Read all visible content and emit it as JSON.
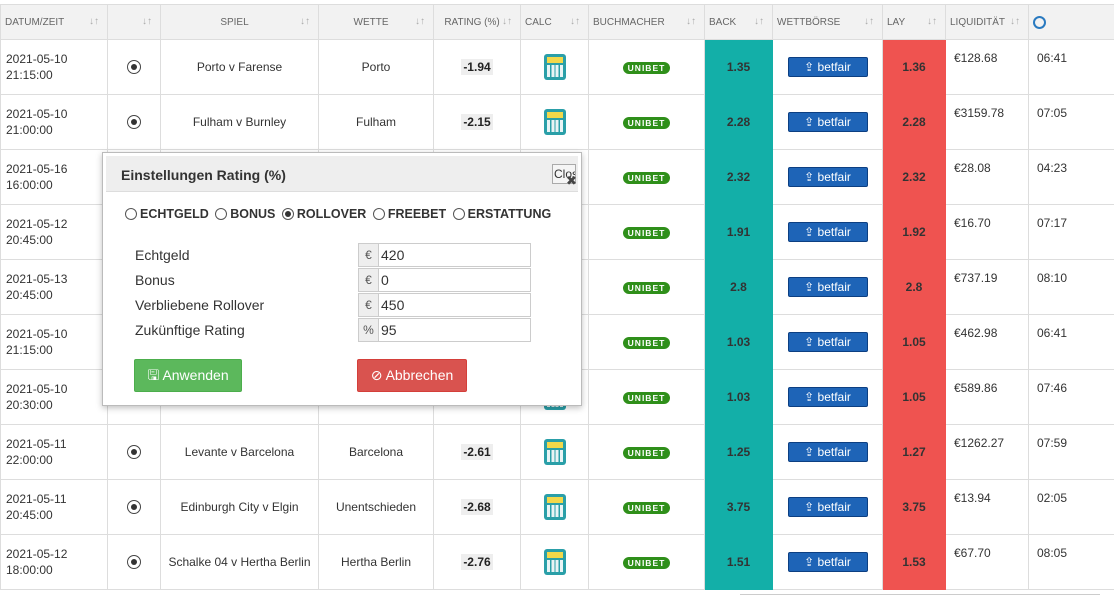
{
  "columns": [
    {
      "label": "DATUM/ZEIT",
      "sort": "↓↑"
    },
    {
      "label": "",
      "sort": "↓↑"
    },
    {
      "label": "SPIEL",
      "sort": "↓↑"
    },
    {
      "label": "WETTE",
      "sort": "↓↑"
    },
    {
      "label": "RATING (%)",
      "sort": "↓↑"
    },
    {
      "label": "CALC",
      "sort": "↓↑"
    },
    {
      "label": "BUCHMACHER",
      "sort": "↓↑"
    },
    {
      "label": "BACK",
      "sort": "↓↑"
    },
    {
      "label": "WETTBÖRSE",
      "sort": "↓↑"
    },
    {
      "label": "LAY",
      "sort": "↓↑"
    },
    {
      "label": "LIQUIDITÄT",
      "sort": "↓↑"
    },
    {
      "label": "",
      "sort": ""
    }
  ],
  "rows": [
    {
      "date": "2021-05-10",
      "time": "21:15:00",
      "match": "Porto v Farense",
      "bet": "Porto",
      "rating": "-1.94",
      "back": "1.35",
      "lay": "1.36",
      "liquidity": "€128.68",
      "eta": "06:41"
    },
    {
      "date": "2021-05-10",
      "time": "21:00:00",
      "match": "Fulham v Burnley",
      "bet": "Fulham",
      "rating": "-2.15",
      "back": "2.28",
      "lay": "2.28",
      "liquidity": "€3159.78",
      "eta": "07:05"
    },
    {
      "date": "2021-05-16",
      "time": "16:00:00",
      "match": "",
      "bet": "",
      "rating": "",
      "back": "2.32",
      "lay": "2.32",
      "liquidity": "€28.08",
      "eta": "04:23"
    },
    {
      "date": "2021-05-12",
      "time": "20:45:00",
      "match": "",
      "bet": "",
      "rating": "",
      "back": "1.91",
      "lay": "1.92",
      "liquidity": "€16.70",
      "eta": "07:17"
    },
    {
      "date": "2021-05-13",
      "time": "20:45:00",
      "match": "",
      "bet": "",
      "rating": "",
      "back": "2.8",
      "lay": "2.8",
      "liquidity": "€737.19",
      "eta": "08:10"
    },
    {
      "date": "2021-05-10",
      "time": "21:15:00",
      "match": "",
      "bet": "",
      "rating": "",
      "back": "1.03",
      "lay": "1.05",
      "liquidity": "€462.98",
      "eta": "06:41"
    },
    {
      "date": "2021-05-10",
      "time": "20:30:00",
      "match": "",
      "bet": "",
      "rating": "",
      "back": "1.03",
      "lay": "1.05",
      "liquidity": "€589.86",
      "eta": "07:46"
    },
    {
      "date": "2021-05-11",
      "time": "22:00:00",
      "match": "Levante v Barcelona",
      "bet": "Barcelona",
      "rating": "-2.61",
      "back": "1.25",
      "lay": "1.27",
      "liquidity": "€1262.27",
      "eta": "07:59"
    },
    {
      "date": "2021-05-11",
      "time": "20:45:00",
      "match": "Edinburgh City v Elgin",
      "bet": "Unentschieden",
      "rating": "-2.68",
      "back": "3.75",
      "lay": "3.75",
      "liquidity": "€13.94",
      "eta": "02:05"
    },
    {
      "date": "2021-05-12",
      "time": "18:00:00",
      "match": "Schalke 04 v Hertha Berlin",
      "bet": "Hertha Berlin",
      "rating": "-2.76",
      "back": "1.51",
      "lay": "1.53",
      "liquidity": "€67.70",
      "eta": "08:05"
    }
  ],
  "bookmaker_logo_text": "UNIBET",
  "exchange_logo_text": "betfair",
  "icons": {
    "sport": "soccer-ball-icon",
    "calc": "calculator-icon",
    "clock": "clock-icon"
  },
  "colors": {
    "back": "#13afa8",
    "lay": "#ef5350",
    "ok": "#5cb85c",
    "cancel": "#d9534f"
  },
  "modal": {
    "title": "Einstellungen Rating (%)",
    "close_label": "Close",
    "options": [
      {
        "label": "ECHTGELD",
        "checked": false
      },
      {
        "label": "BONUS",
        "checked": false
      },
      {
        "label": "ROLLOVER",
        "checked": true
      },
      {
        "label": "FREEBET",
        "checked": false
      },
      {
        "label": "ERSTATTUNG",
        "checked": false
      }
    ],
    "fields": [
      {
        "label": "Echtgeld",
        "prefix": "€",
        "value": "420"
      },
      {
        "label": "Bonus",
        "prefix": "€",
        "value": "0"
      },
      {
        "label": "Verbliebene Rollover",
        "prefix": "€",
        "value": "450"
      },
      {
        "label": "Zukünftige Rating",
        "prefix": "%",
        "value": "95"
      }
    ],
    "apply_label": "Anwenden",
    "cancel_label": "Abbrechen"
  }
}
